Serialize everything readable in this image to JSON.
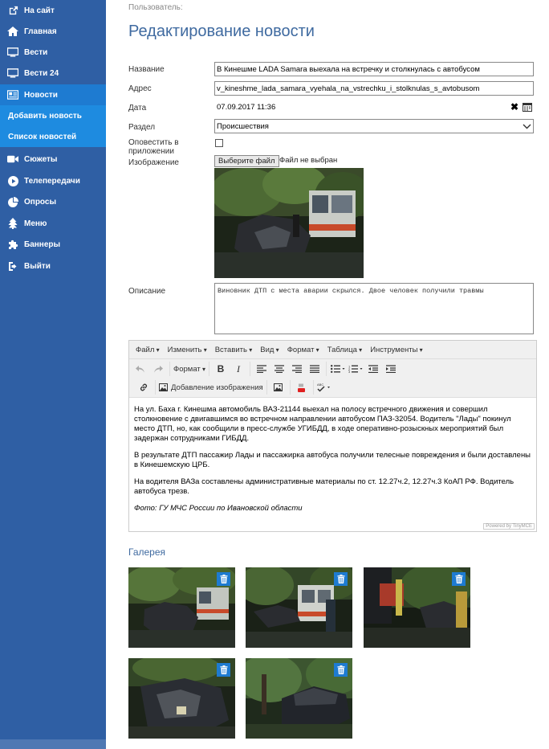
{
  "sidebar": {
    "items": [
      {
        "label": "На сайт",
        "icon": "external-link-icon"
      },
      {
        "label": "Главная",
        "icon": "home-icon"
      },
      {
        "label": "Вести",
        "icon": "monitor-icon"
      },
      {
        "label": "Вести 24",
        "icon": "monitor-icon"
      },
      {
        "label": "Новости",
        "icon": "newspaper-icon"
      },
      {
        "label": "Добавить новость",
        "icon": ""
      },
      {
        "label": "Список новостей",
        "icon": ""
      },
      {
        "label": "Сюжеты",
        "icon": "video-camera-icon"
      },
      {
        "label": "Телепередачи",
        "icon": "play-icon"
      },
      {
        "label": "Опросы",
        "icon": "pie-chart-icon"
      },
      {
        "label": "Меню",
        "icon": "tree-icon"
      },
      {
        "label": "Баннеры",
        "icon": "puzzle-icon"
      },
      {
        "label": "Выйти",
        "icon": "sign-out-icon"
      }
    ]
  },
  "header": {
    "breadcrumb": "Пользователь:",
    "title": "Редактирование новости"
  },
  "form": {
    "title_label": "Название",
    "title_value": "В Кинешме LADA Samara выехала на встречку и столкнулась с автобусом",
    "address_label": "Адрес",
    "address_value": "v_kineshme_lada_samara_vyehala_na_vstrechku_i_stolknulas_s_avtobusom",
    "date_label": "Дата",
    "date_value": "07.09.2017 11:36",
    "section_label": "Раздел",
    "section_value": "Происшествия",
    "notify_label": "Оповестить в приложении",
    "image_label": "Изображение",
    "file_button": "Выберите файл",
    "file_status": "Файл не выбран",
    "description_label": "Описание",
    "description_value": "Виновник ДТП с места аварии скрылся. Двое человек получили травмы"
  },
  "editor": {
    "menu": [
      "Файл",
      "Изменить",
      "Вставить",
      "Вид",
      "Формат",
      "Таблица",
      "Инструменты"
    ],
    "format_label": "Формат",
    "image_button": "Добавление изображения",
    "paragraphs": [
      "На ул. Баха г. Кинешма автомобиль ВАЗ-21144 выехал на полосу встречного движения и совершил столкновение с двигавшимся во встречном направлении автобусом ПАЗ-32054. Водитель \"Лады\" покинул место ДТП, но, как сообщили в пресс-службе УГИБДД, в ходе оперативно-розыскных мероприятий был задержан сотрудниками ГИБДД.",
      "В результате ДТП пассажир Лады и пассажирка автобуса получили телесные повреждения и были доставлены в Кинешемскую ЦРБ.",
      "На водителя ВАЗа составлены административные материалы по ст. 12.27ч.2, 12.27ч.3 КоАП РФ. Водитель автобуса трезв."
    ],
    "caption": "Фото: ГУ МЧС России по Ивановской области",
    "powered": "Powered by TinyMCE"
  },
  "gallery": {
    "title": "Галерея"
  },
  "colors": {
    "sidebar": "#2f5fa4",
    "active": "#1e7bd1",
    "title": "#3f6aa0"
  }
}
